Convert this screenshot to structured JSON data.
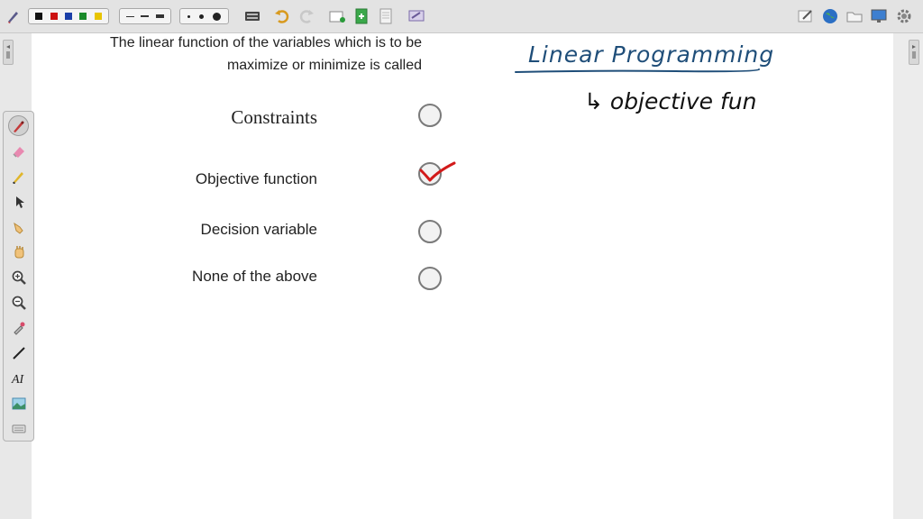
{
  "question": {
    "line1": "The linear function of the variables which is to be",
    "line2": "maximize or minimize is called"
  },
  "options": [
    {
      "label": "Constraints",
      "checked": false
    },
    {
      "label": "Objective function",
      "checked": true
    },
    {
      "label": "Decision variable",
      "checked": false
    },
    {
      "label": "None of the above",
      "checked": false
    }
  ],
  "notes": {
    "heading": "Linear Programming",
    "line1": "↳ objective fun"
  },
  "colors": {
    "ink_blue": "#1f4e79",
    "ink_black": "#111111",
    "check_red": "#d21a1a",
    "palette": [
      "#111111",
      "#cc1111",
      "#1b3fa8",
      "#1a8a2a",
      "#e8c400"
    ]
  },
  "icons": {
    "toolbar": [
      "pen-icon",
      "palette-group",
      "line-width-group",
      "dot-size-group",
      "keyboard-icon",
      "undo-icon",
      "redo-icon",
      "new-page-icon",
      "add-page-icon",
      "page-icon",
      "screen-capture-icon"
    ],
    "toolbar_right": [
      "edit-icon",
      "globe-icon",
      "folder-icon",
      "monitor-icon",
      "settings-icon"
    ],
    "tools": [
      "pen-tool-icon",
      "eraser-icon",
      "highlighter-icon",
      "pointer-icon",
      "hand-point-icon",
      "hand-pan-icon",
      "zoom-in-icon",
      "zoom-out-icon",
      "eyedropper-icon",
      "line-tool-icon",
      "text-tool-icon",
      "image-tool-icon",
      "keyboard-tool-icon"
    ]
  }
}
